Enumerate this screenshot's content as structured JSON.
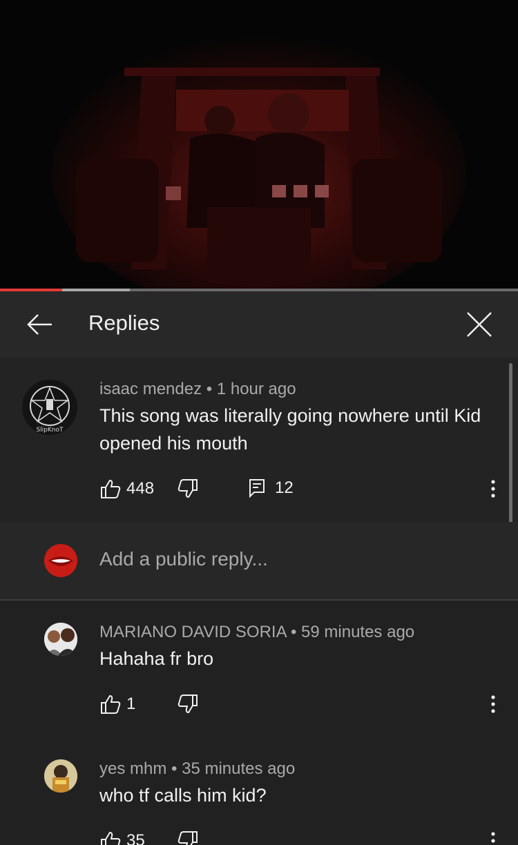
{
  "player": {
    "progress_played": 0.12,
    "progress_buffered": 0.25
  },
  "header": {
    "title": "Replies",
    "back_icon": "arrow-back-icon",
    "close_icon": "close-icon"
  },
  "parent_comment": {
    "author": "isaac mendez",
    "time": "1 hour ago",
    "separator": "•",
    "text_line1": "This song was literally going nowhere until Kid",
    "text_line2": "opened his mouth",
    "likes": "448",
    "replies": "12",
    "avatar_text": "SlipKnoT"
  },
  "composer": {
    "placeholder": "Add a public reply..."
  },
  "replies": [
    {
      "author": "MARIANO DAVID SORIA",
      "time": "59 minutes ago",
      "text": "Hahaha fr bro",
      "likes": "1"
    },
    {
      "author": "yes mhm",
      "time": "35 minutes ago",
      "text": "who tf calls him kid?",
      "likes": "35"
    }
  ],
  "colors": {
    "accent_red": "#e53935",
    "background": "#212121",
    "secondary_text": "#aaaaaa"
  }
}
